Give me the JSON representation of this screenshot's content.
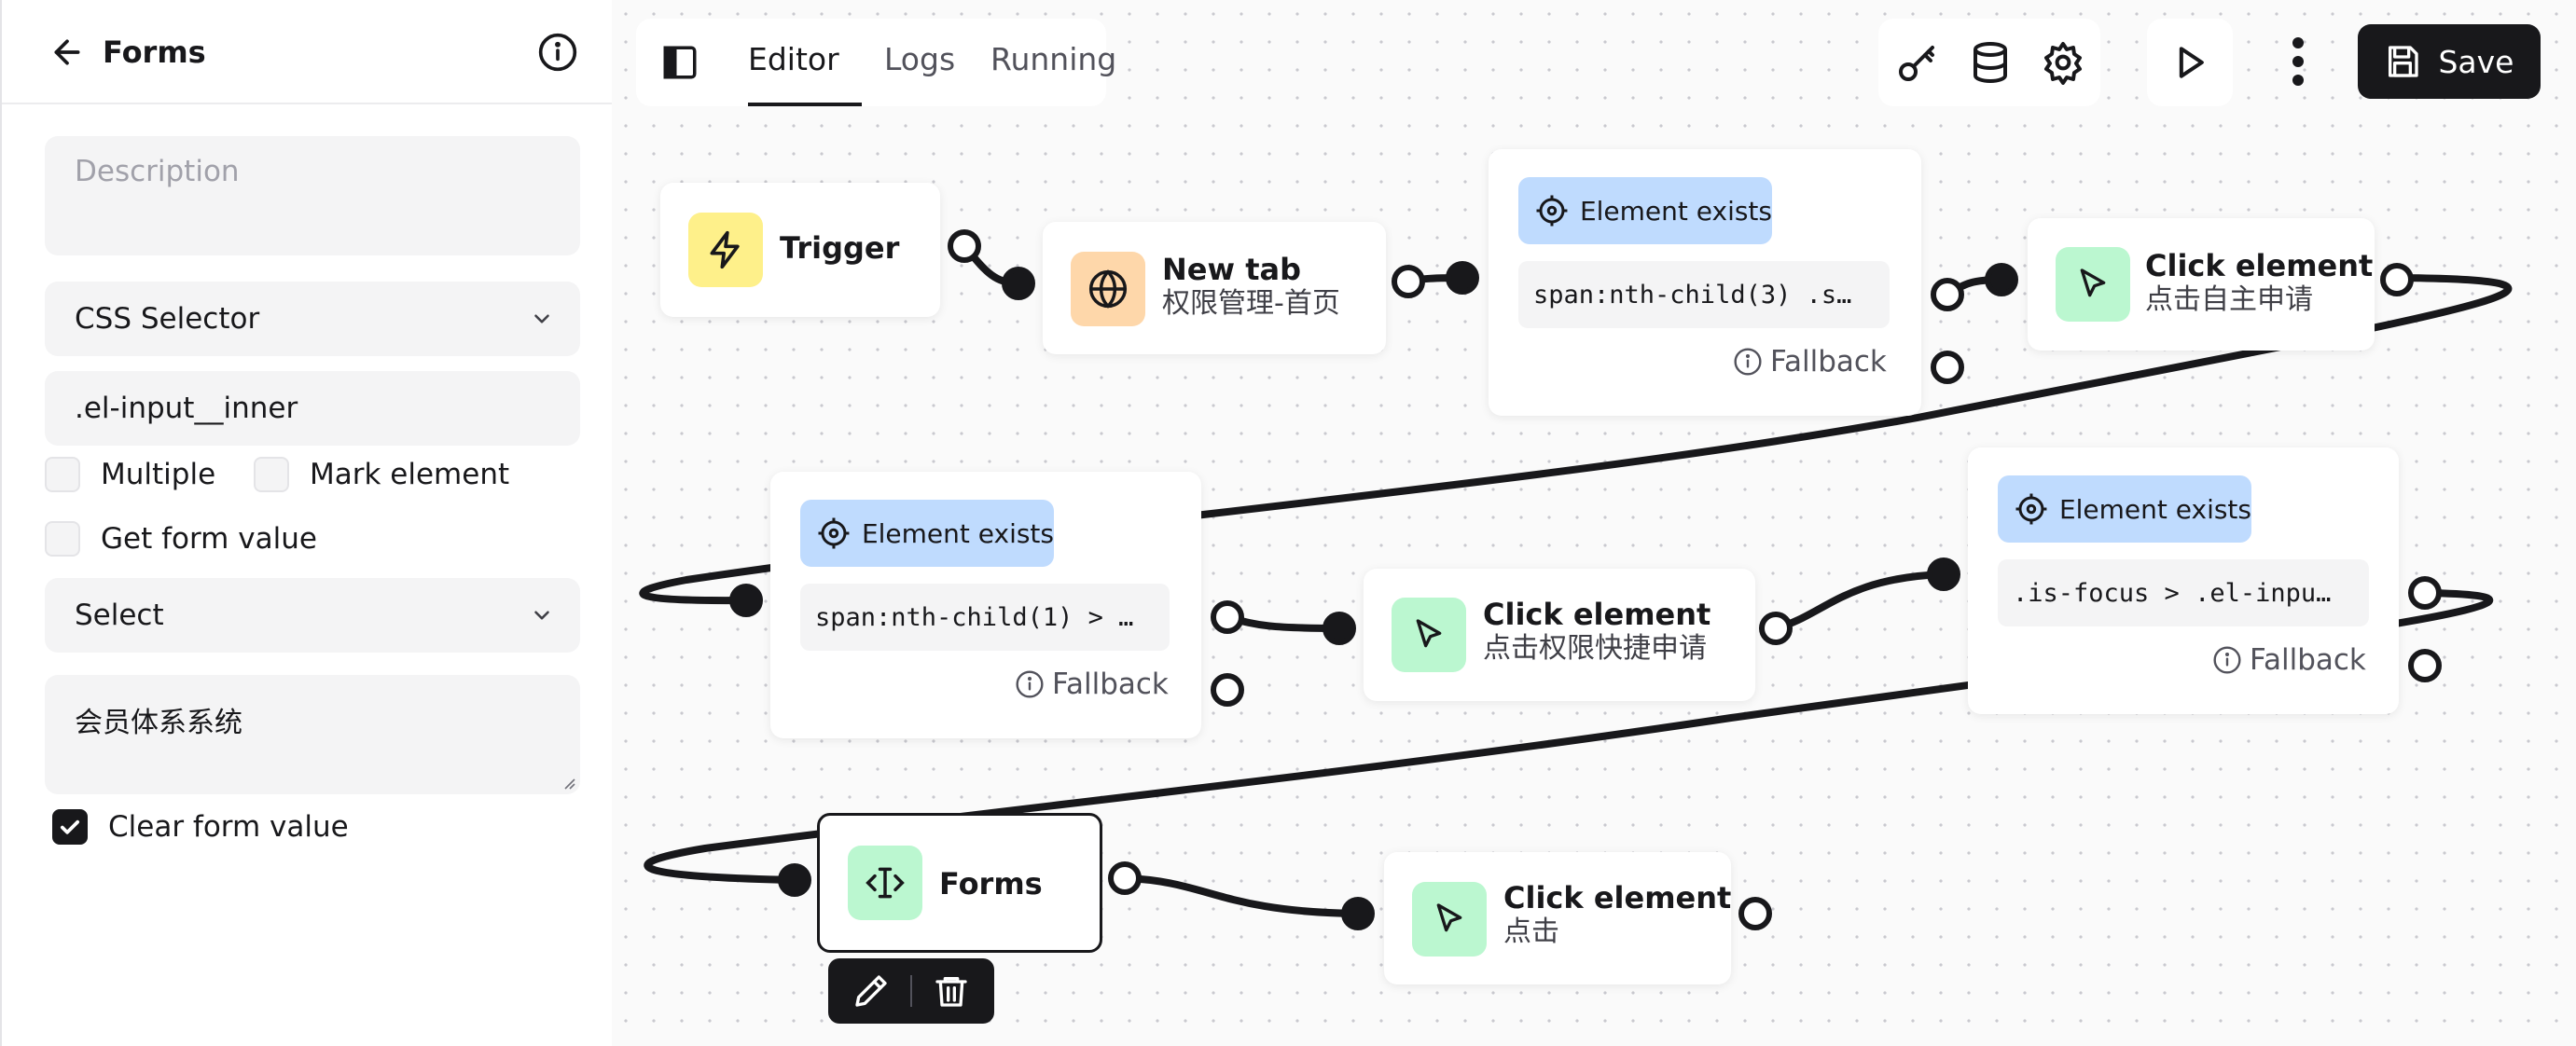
{
  "sidebar": {
    "title": "Forms",
    "description_placeholder": "Description",
    "selector_type": "CSS Selector",
    "selector_value": ".el-input__inner",
    "checkboxes": {
      "multiple": "Multiple",
      "mark_element": "Mark element",
      "get_form_value": "Get form value",
      "clear_form_value": "Clear form value"
    },
    "form_type": "Select",
    "value_text": "会员体系系统"
  },
  "toolbar": {
    "tabs": [
      "Editor",
      "Logs",
      "Running"
    ],
    "active_tab": "Editor",
    "save_label": "Save",
    "icons": [
      "sidebar-toggle-icon",
      "key-icon",
      "database-icon",
      "settings-icon",
      "play-icon",
      "more-vertical-icon",
      "save-icon"
    ]
  },
  "nodes": {
    "trigger": {
      "title": "Trigger"
    },
    "new_tab": {
      "title": "New tab",
      "subtitle": "权限管理-首页"
    },
    "exists1": {
      "label": "Element exists",
      "code": "span:nth-child(3) .s…",
      "fallback": "Fallback"
    },
    "click1": {
      "title": "Click element",
      "subtitle": "点击自主申请"
    },
    "exists2": {
      "label": "Element exists",
      "code": "span:nth-child(1) > …",
      "fallback": "Fallback"
    },
    "click2": {
      "title": "Click element",
      "subtitle": "点击权限快捷申请"
    },
    "exists3": {
      "label": "Element exists",
      "code": ".is-focus > .el-inpu…",
      "fallback": "Fallback"
    },
    "forms": {
      "title": "Forms"
    },
    "click3": {
      "title": "Click element",
      "subtitle": "点击"
    }
  },
  "colors": {
    "trigger_icon_bg": "#fef08a",
    "newtab_icon_bg": "#fed7aa",
    "click_icon_bg": "#bbf7d0",
    "exists_pill_bg": "#bfdbfe",
    "primary": "#18181b"
  }
}
